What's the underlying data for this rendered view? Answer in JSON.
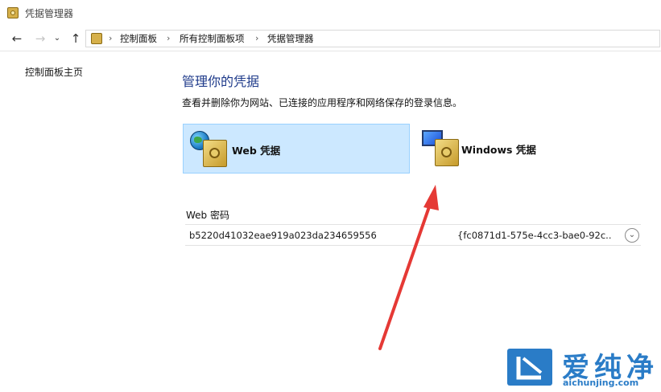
{
  "window": {
    "title": "凭据管理器"
  },
  "nav": {
    "back_icon": "arrow-left-icon",
    "forward_icon": "arrow-right-icon",
    "history_icon": "chevron-down-icon",
    "up_icon": "arrow-up-icon",
    "breadcrumbs": [
      "控制面板",
      "所有控制面板项",
      "凭据管理器"
    ]
  },
  "sidebar": {
    "home_link": "控制面板主页"
  },
  "main": {
    "title": "管理你的凭据",
    "description": "查看并删除你为网站、已连接的应用程序和网络保存的登录信息。",
    "tiles": [
      {
        "label": "Web 凭据",
        "selected": true
      },
      {
        "label": "Windows 凭据",
        "selected": false
      }
    ],
    "web_passwords": {
      "section_title": "Web 密码",
      "rows": [
        {
          "name": "b5220d41032eae919a023da234659556",
          "value": "{fc0871d1-575e-4cc3-bae0-92c..."
        }
      ]
    }
  },
  "annotation": {
    "arrow_color": "#e53935"
  },
  "watermark": {
    "text": "爱纯净",
    "url": "aichunjing.com",
    "color": "#2a7cc7"
  }
}
